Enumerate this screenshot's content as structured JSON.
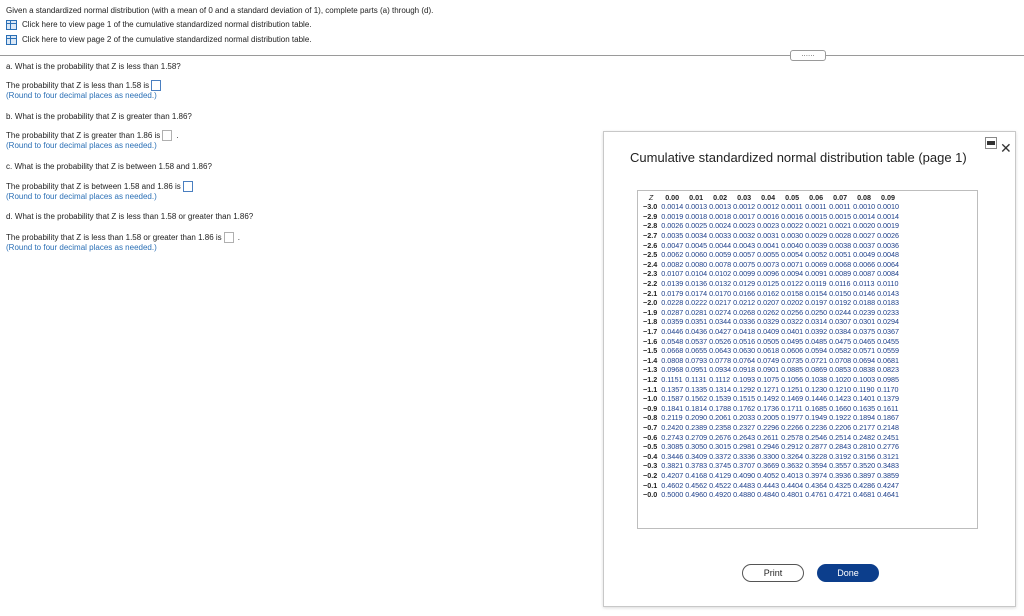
{
  "intro": {
    "text": "Given a standardized normal distribution (with a mean of 0 and a standard deviation of 1), complete parts (a) through (d).",
    "link1": "Click here to view page 1 of the cumulative standardized normal distribution table.",
    "link2": "Click here to view page 2 of the cumulative standardized normal distribution table."
  },
  "handle": "......",
  "questions": {
    "a": {
      "label": "a. What is the probability that Z is less than 1.58?",
      "answer": "The probability that Z is less than 1.58 is",
      "hint": "(Round to four decimal places as needed.)"
    },
    "b": {
      "label": "b. What is the probability that Z is greater than 1.86?",
      "answer": "The probability that Z is greater than 1.86 is",
      "hint": "(Round to four decimal places as needed.)"
    },
    "c": {
      "label": "c. What is the probability that Z is between 1.58 and 1.86?",
      "answer": "The probability that Z is between 1.58 and 1.86 is",
      "hint": "(Round to four decimal places as needed.)"
    },
    "d": {
      "label": "d. What is the probability that Z is less than 1.58 or greater than 1.86?",
      "answer": "The probability that Z is less than 1.58 or greater than 1.86 is",
      "hint": "(Round to four decimal places as needed.)"
    }
  },
  "dialog": {
    "title": "Cumulative standardized normal distribution table (page 1)",
    "close": "✕",
    "print": "Print",
    "done": "Done"
  },
  "table": {
    "corner": "Z",
    "headers": [
      "0.00",
      "0.01",
      "0.02",
      "0.03",
      "0.04",
      "0.05",
      "0.06",
      "0.07",
      "0.08",
      "0.09"
    ],
    "rows": [
      {
        "z": "−3.0",
        "v": [
          "0.0014",
          "0.0013",
          "0.0013",
          "0.0012",
          "0.0012",
          "0.0011",
          "0.0011",
          "0.0011",
          "0.0010",
          "0.0010"
        ]
      },
      {
        "z": "−2.9",
        "v": [
          "0.0019",
          "0.0018",
          "0.0018",
          "0.0017",
          "0.0016",
          "0.0016",
          "0.0015",
          "0.0015",
          "0.0014",
          "0.0014"
        ]
      },
      {
        "z": "−2.8",
        "v": [
          "0.0026",
          "0.0025",
          "0.0024",
          "0.0023",
          "0.0023",
          "0.0022",
          "0.0021",
          "0.0021",
          "0.0020",
          "0.0019"
        ]
      },
      {
        "z": "−2.7",
        "v": [
          "0.0035",
          "0.0034",
          "0.0033",
          "0.0032",
          "0.0031",
          "0.0030",
          "0.0029",
          "0.0028",
          "0.0027",
          "0.0026"
        ]
      },
      {
        "z": "−2.6",
        "v": [
          "0.0047",
          "0.0045",
          "0.0044",
          "0.0043",
          "0.0041",
          "0.0040",
          "0.0039",
          "0.0038",
          "0.0037",
          "0.0036"
        ]
      },
      {
        "z": "−2.5",
        "v": [
          "0.0062",
          "0.0060",
          "0.0059",
          "0.0057",
          "0.0055",
          "0.0054",
          "0.0052",
          "0.0051",
          "0.0049",
          "0.0048"
        ]
      },
      {
        "z": "−2.4",
        "v": [
          "0.0082",
          "0.0080",
          "0.0078",
          "0.0075",
          "0.0073",
          "0.0071",
          "0.0069",
          "0.0068",
          "0.0066",
          "0.0064"
        ]
      },
      {
        "z": "−2.3",
        "v": [
          "0.0107",
          "0.0104",
          "0.0102",
          "0.0099",
          "0.0096",
          "0.0094",
          "0.0091",
          "0.0089",
          "0.0087",
          "0.0084"
        ]
      },
      {
        "z": "−2.2",
        "v": [
          "0.0139",
          "0.0136",
          "0.0132",
          "0.0129",
          "0.0125",
          "0.0122",
          "0.0119",
          "0.0116",
          "0.0113",
          "0.0110"
        ]
      },
      {
        "z": "−2.1",
        "v": [
          "0.0179",
          "0.0174",
          "0.0170",
          "0.0166",
          "0.0162",
          "0.0158",
          "0.0154",
          "0.0150",
          "0.0146",
          "0.0143"
        ]
      },
      {
        "z": "−2.0",
        "v": [
          "0.0228",
          "0.0222",
          "0.0217",
          "0.0212",
          "0.0207",
          "0.0202",
          "0.0197",
          "0.0192",
          "0.0188",
          "0.0183"
        ]
      },
      {
        "z": "−1.9",
        "v": [
          "0.0287",
          "0.0281",
          "0.0274",
          "0.0268",
          "0.0262",
          "0.0256",
          "0.0250",
          "0.0244",
          "0.0239",
          "0.0233"
        ]
      },
      {
        "z": "−1.8",
        "v": [
          "0.0359",
          "0.0351",
          "0.0344",
          "0.0336",
          "0.0329",
          "0.0322",
          "0.0314",
          "0.0307",
          "0.0301",
          "0.0294"
        ]
      },
      {
        "z": "−1.7",
        "v": [
          "0.0446",
          "0.0436",
          "0.0427",
          "0.0418",
          "0.0409",
          "0.0401",
          "0.0392",
          "0.0384",
          "0.0375",
          "0.0367"
        ]
      },
      {
        "z": "−1.6",
        "v": [
          "0.0548",
          "0.0537",
          "0.0526",
          "0.0516",
          "0.0505",
          "0.0495",
          "0.0485",
          "0.0475",
          "0.0465",
          "0.0455"
        ]
      },
      {
        "z": "−1.5",
        "v": [
          "0.0668",
          "0.0655",
          "0.0643",
          "0.0630",
          "0.0618",
          "0.0606",
          "0.0594",
          "0.0582",
          "0.0571",
          "0.0559"
        ]
      },
      {
        "z": "−1.4",
        "v": [
          "0.0808",
          "0.0793",
          "0.0778",
          "0.0764",
          "0.0749",
          "0.0735",
          "0.0721",
          "0.0708",
          "0.0694",
          "0.0681"
        ]
      },
      {
        "z": "−1.3",
        "v": [
          "0.0968",
          "0.0951",
          "0.0934",
          "0.0918",
          "0.0901",
          "0.0885",
          "0.0869",
          "0.0853",
          "0.0838",
          "0.0823"
        ]
      },
      {
        "z": "−1.2",
        "v": [
          "0.1151",
          "0.1131",
          "0.1112",
          "0.1093",
          "0.1075",
          "0.1056",
          "0.1038",
          "0.1020",
          "0.1003",
          "0.0985"
        ]
      },
      {
        "z": "−1.1",
        "v": [
          "0.1357",
          "0.1335",
          "0.1314",
          "0.1292",
          "0.1271",
          "0.1251",
          "0.1230",
          "0.1210",
          "0.1190",
          "0.1170"
        ]
      },
      {
        "z": "−1.0",
        "v": [
          "0.1587",
          "0.1562",
          "0.1539",
          "0.1515",
          "0.1492",
          "0.1469",
          "0.1446",
          "0.1423",
          "0.1401",
          "0.1379"
        ]
      },
      {
        "z": "−0.9",
        "v": [
          "0.1841",
          "0.1814",
          "0.1788",
          "0.1762",
          "0.1736",
          "0.1711",
          "0.1685",
          "0.1660",
          "0.1635",
          "0.1611"
        ]
      },
      {
        "z": "−0.8",
        "v": [
          "0.2119",
          "0.2090",
          "0.2061",
          "0.2033",
          "0.2005",
          "0.1977",
          "0.1949",
          "0.1922",
          "0.1894",
          "0.1867"
        ]
      },
      {
        "z": "−0.7",
        "v": [
          "0.2420",
          "0.2389",
          "0.2358",
          "0.2327",
          "0.2296",
          "0.2266",
          "0.2236",
          "0.2206",
          "0.2177",
          "0.2148"
        ]
      },
      {
        "z": "−0.6",
        "v": [
          "0.2743",
          "0.2709",
          "0.2676",
          "0.2643",
          "0.2611",
          "0.2578",
          "0.2546",
          "0.2514",
          "0.2482",
          "0.2451"
        ]
      },
      {
        "z": "−0.5",
        "v": [
          "0.3085",
          "0.3050",
          "0.3015",
          "0.2981",
          "0.2946",
          "0.2912",
          "0.2877",
          "0.2843",
          "0.2810",
          "0.2776"
        ]
      },
      {
        "z": "−0.4",
        "v": [
          "0.3446",
          "0.3409",
          "0.3372",
          "0.3336",
          "0.3300",
          "0.3264",
          "0.3228",
          "0.3192",
          "0.3156",
          "0.3121"
        ]
      },
      {
        "z": "−0.3",
        "v": [
          "0.3821",
          "0.3783",
          "0.3745",
          "0.3707",
          "0.3669",
          "0.3632",
          "0.3594",
          "0.3557",
          "0.3520",
          "0.3483"
        ]
      },
      {
        "z": "−0.2",
        "v": [
          "0.4207",
          "0.4168",
          "0.4129",
          "0.4090",
          "0.4052",
          "0.4013",
          "0.3974",
          "0.3936",
          "0.3897",
          "0.3859"
        ]
      },
      {
        "z": "−0.1",
        "v": [
          "0.4602",
          "0.4562",
          "0.4522",
          "0.4483",
          "0.4443",
          "0.4404",
          "0.4364",
          "0.4325",
          "0.4286",
          "0.4247"
        ]
      },
      {
        "z": "−0.0",
        "v": [
          "0.5000",
          "0.4960",
          "0.4920",
          "0.4880",
          "0.4840",
          "0.4801",
          "0.4761",
          "0.4721",
          "0.4681",
          "0.4641"
        ]
      }
    ]
  }
}
